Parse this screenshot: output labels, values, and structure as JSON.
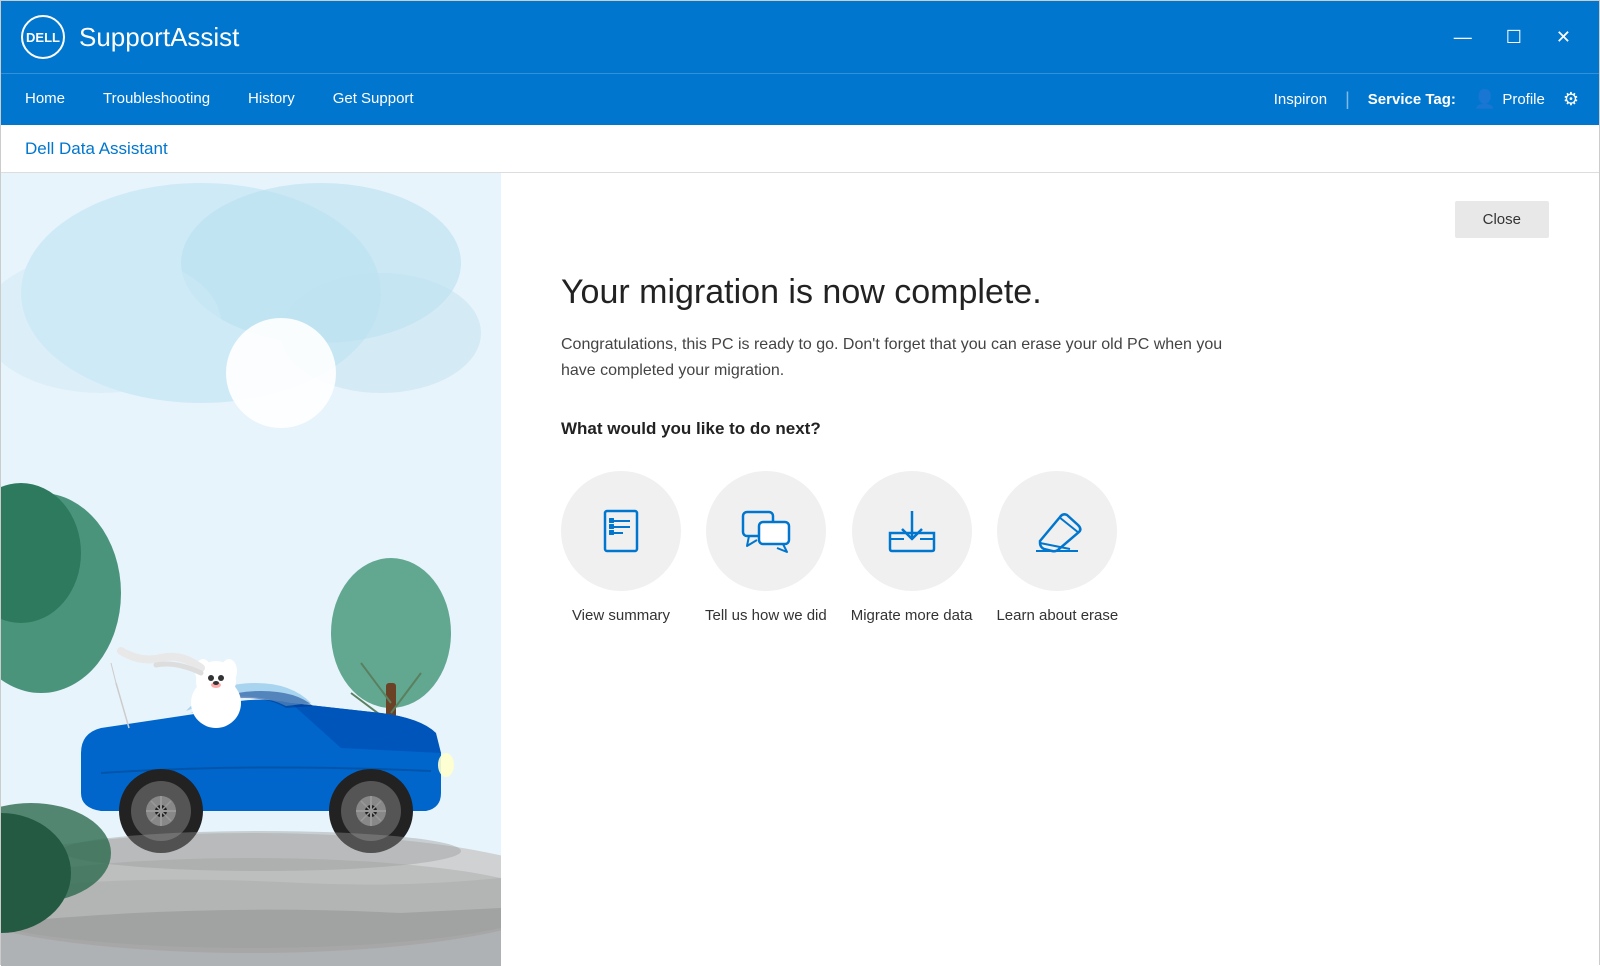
{
  "titleBar": {
    "logo": "DELL",
    "appTitle": "SupportAssist",
    "minimize": "—",
    "maximize": "☐",
    "close": "✕"
  },
  "navBar": {
    "items": [
      {
        "id": "home",
        "label": "Home"
      },
      {
        "id": "troubleshooting",
        "label": "Troubleshooting"
      },
      {
        "id": "history",
        "label": "History"
      },
      {
        "id": "get-support",
        "label": "Get Support"
      }
    ],
    "deviceName": "Inspiron",
    "serviceTagLabel": "Service Tag:",
    "serviceTagValue": "",
    "profileLabel": "Profile",
    "separator": "|"
  },
  "subHeader": {
    "title": "Dell Data Assistant"
  },
  "content": {
    "closeButton": "Close",
    "migrationTitle": "Your migration is now complete.",
    "migrationDesc": "Congratulations, this PC is ready to go. Don't forget that you can erase your old PC when you have completed your migration.",
    "nextLabel": "What would you like to do next?",
    "actions": [
      {
        "id": "view-summary",
        "label": "View summary"
      },
      {
        "id": "tell-us",
        "label": "Tell us how we did"
      },
      {
        "id": "migrate-more",
        "label": "Migrate more data"
      },
      {
        "id": "learn-erase",
        "label": "Learn about erase"
      }
    ]
  }
}
